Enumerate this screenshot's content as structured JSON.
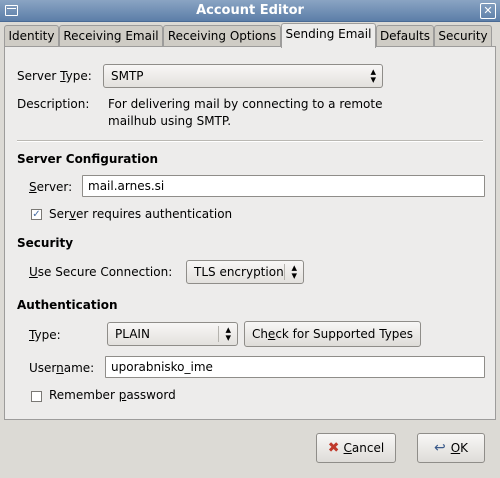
{
  "window": {
    "title": "Account Editor"
  },
  "tabs": [
    {
      "label": "Identity"
    },
    {
      "label": "Receiving Email"
    },
    {
      "label": "Receiving Options"
    },
    {
      "label": "Sending Email"
    },
    {
      "label": "Defaults"
    },
    {
      "label": "Security"
    }
  ],
  "sending": {
    "server_type": {
      "label_pre": "Server ",
      "label_key": "T",
      "label_post": "ype:",
      "value": "SMTP"
    },
    "description": {
      "label": "Description:",
      "line1": "For delivering mail by connecting to a remote",
      "line2": "mailhub using SMTP."
    },
    "server_config": {
      "heading": "Server Configuration",
      "server_label_key": "S",
      "server_label_post": "erver:",
      "server_value": "mail.arnes.si",
      "requires_auth_pre": "Ser",
      "requires_auth_key": "v",
      "requires_auth_post": "er requires authentication",
      "requires_auth_checked": true
    },
    "security": {
      "heading": "Security",
      "label_key": "U",
      "label_post": "se Secure Connection:",
      "value": "TLS encryption"
    },
    "authentication": {
      "heading": "Authentication",
      "type_label_key": "T",
      "type_label_post": "ype:",
      "type_value": "PLAIN",
      "check_pre": "Ch",
      "check_key": "e",
      "check_post": "ck for Supported Types",
      "username_pre": "User",
      "username_key": "n",
      "username_post": "ame:",
      "username_value": "uporabnisko_ime",
      "remember_pre": "Remember ",
      "remember_key": "p",
      "remember_post": "assword",
      "remember_checked": false
    }
  },
  "buttons": {
    "cancel_key": "C",
    "cancel_post": "ancel",
    "ok_key": "O",
    "ok_post": "K"
  }
}
